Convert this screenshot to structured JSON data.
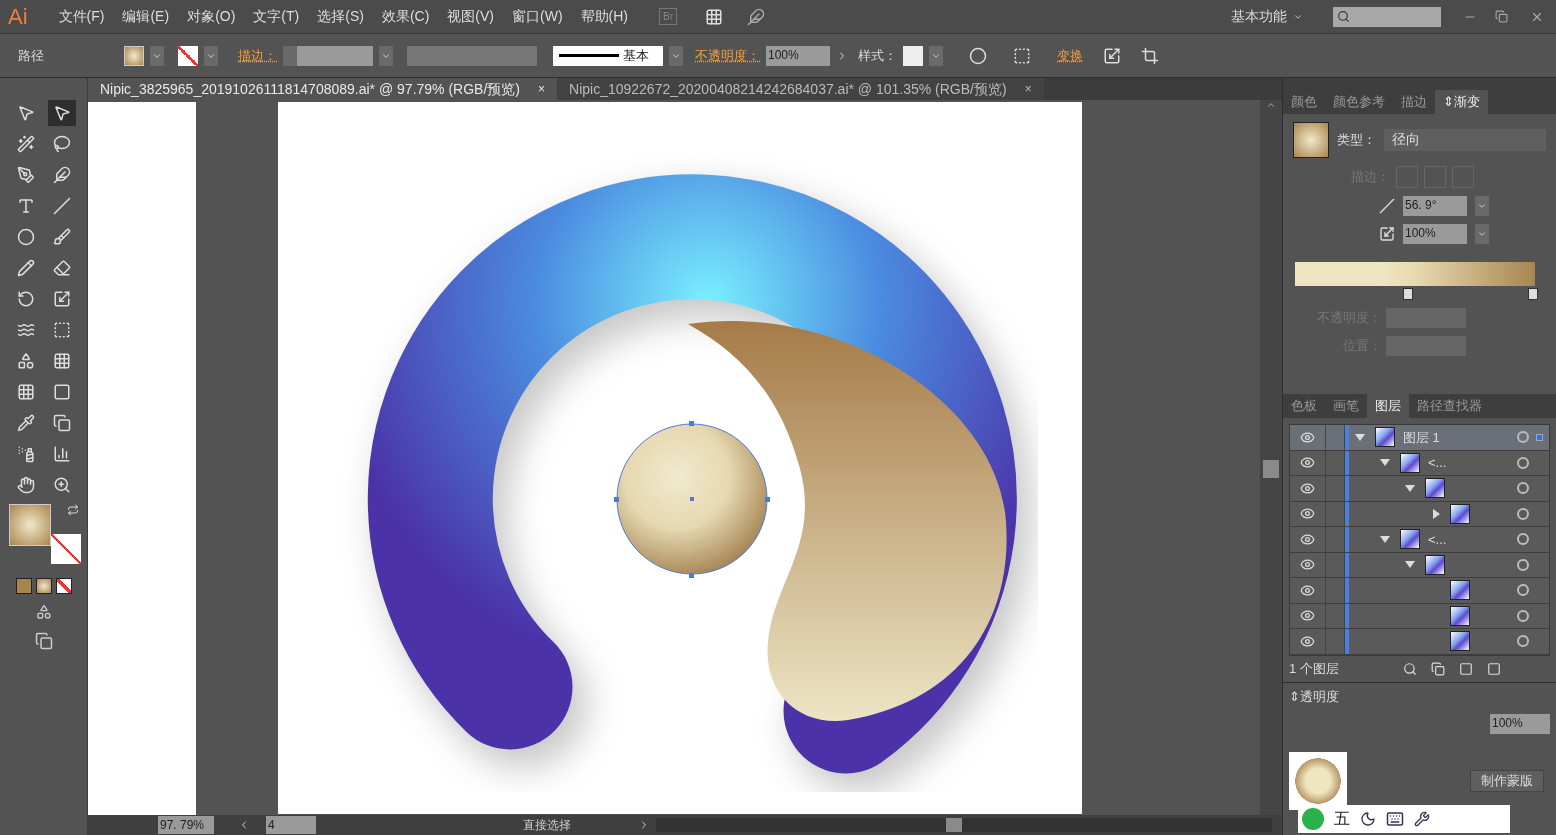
{
  "menu_bar": {
    "logo": "Ai",
    "items": [
      "文件(F)",
      "编辑(E)",
      "对象(O)",
      "文字(T)",
      "选择(S)",
      "效果(C)",
      "视图(V)",
      "窗口(W)",
      "帮助(H)"
    ],
    "bridge": "Br",
    "workspace": "基本功能"
  },
  "control_bar": {
    "selection": "路径",
    "stroke_label": "描边：",
    "stroke_style": "基本",
    "opacity_label": "不透明度：",
    "opacity": "100%",
    "style_label": "样式：",
    "transform": "变换"
  },
  "document_tabs": [
    {
      "title": "Nipic_3825965_20191026111814708089.ai* @ 97.79% (RGB/预览)",
      "close": "×",
      "selected": true
    },
    {
      "title": "Nipic_10922672_20200408214242684037.ai* @ 101.35% (RGB/预览)",
      "close": "×",
      "selected": false
    }
  ],
  "tools": [
    {
      "selected": false
    },
    {
      "selected": true
    },
    {
      "selected": false
    },
    {
      "selected": false
    },
    {
      "selected": false
    },
    {
      "selected": false
    },
    {
      "selected": false
    },
    {
      "selected": false
    },
    {
      "selected": false
    },
    {
      "selected": false
    },
    {
      "selected": false
    },
    {
      "selected": false
    },
    {
      "selected": false
    },
    {
      "selected": false
    },
    {
      "selected": false
    },
    {
      "selected": false
    },
    {
      "selected": false
    },
    {
      "selected": false
    },
    {
      "selected": false
    },
    {
      "selected": false
    },
    {
      "selected": false
    },
    {
      "selected": false
    },
    {
      "selected": false
    },
    {
      "selected": false
    }
  ],
  "status_bar": {
    "zoom": "97. 79%",
    "artboard": "4",
    "tool": "直接选择"
  },
  "gradient_panel": {
    "tabs": [
      {
        "label": "颜色",
        "selected": false
      },
      {
        "label": "颜色参考",
        "selected": false
      },
      {
        "label": "描边",
        "selected": false
      },
      {
        "label": "⇕渐变",
        "selected": true
      }
    ],
    "type_label": "类型：",
    "type": "径向",
    "stroke_label": "描边：",
    "stroke_disabled": true,
    "angle": "56. 9°",
    "aspect": "100%",
    "stops": [
      {
        "level": 0.47
      },
      {
        "level": 0.99
      }
    ],
    "opacity_label": "不透明度：",
    "position_label": "位置：",
    "fields_disabled": true
  },
  "layers_panel": {
    "tabs": [
      {
        "label": "色板",
        "selected": false
      },
      {
        "label": "画笔",
        "selected": false
      },
      {
        "label": "图层",
        "selected": true
      },
      {
        "label": "路径查找器",
        "selected": false
      }
    ],
    "layers": [
      {
        "name": "图层 1",
        "selected": true,
        "expanded": true,
        "children": [
          {
            "name": "<...",
            "selected": false,
            "expanded": true,
            "children": [
              {
                "selected": false,
                "expanded": true,
                "children": [
                  {
                    "selected": false,
                    "expanded": false
                  }
                ]
              }
            ]
          },
          {
            "name": "<...",
            "selected": false,
            "expanded": true,
            "children": [
              {
                "selected": false,
                "expanded": true,
                "children": [
                  {
                    "selected": false
                  },
                  {
                    "selected": false
                  },
                  {
                    "selected": false
                  }
                ]
              }
            ]
          }
        ]
      }
    ],
    "count": "1 个图层"
  },
  "transparency_panel": {
    "title": "⇕透明度",
    "opacity": "100%",
    "make_mask": "制作蒙版"
  },
  "ime_bar": {
    "mode": "五"
  }
}
